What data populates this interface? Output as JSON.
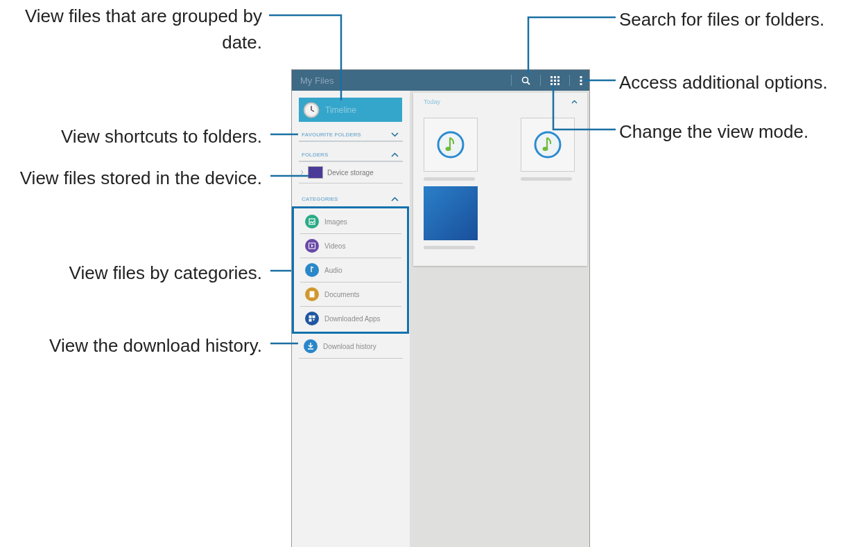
{
  "callouts": [
    {
      "text": "View files that are grouped by date."
    },
    {
      "text": "View shortcuts to folders."
    },
    {
      "text": "View files stored in the device."
    },
    {
      "text": "View files by categories."
    },
    {
      "text": "View the download history."
    },
    {
      "text": "Search for files or folders."
    },
    {
      "text": "Access additional options."
    },
    {
      "text": "Change the view mode."
    }
  ],
  "app": {
    "title": "My Files",
    "actions": [
      {
        "kind": "search"
      },
      {
        "kind": "grid"
      },
      {
        "kind": "more"
      }
    ]
  },
  "timeline": {
    "label": "Timeline",
    "selected": true
  },
  "favourite_folders": {
    "title": "FAVOURITE FOLDERS",
    "expanded": false
  },
  "folders": {
    "title": "FOLDERS",
    "expanded": true,
    "items": [
      {
        "label": "Device storage"
      }
    ]
  },
  "categories": {
    "title": "CATEGORIES",
    "expanded": true,
    "highlighted": true,
    "items": [
      {
        "label": "Images",
        "kind": "images",
        "color": "#2bab86"
      },
      {
        "label": "Videos",
        "kind": "videos",
        "color": "#6a4aa8"
      },
      {
        "label": "Audio",
        "kind": "audio",
        "color": "#2a88c8"
      },
      {
        "label": "Documents",
        "kind": "documents",
        "color": "#d0982e"
      },
      {
        "label": "Downloaded Apps",
        "kind": "apps",
        "color": "#1f56a0"
      }
    ]
  },
  "download_history": {
    "label": "Download history",
    "color": "#2a86c9"
  },
  "content": {
    "date_header": "Today",
    "expanded": true,
    "files": [
      {
        "kind": "audio"
      },
      {
        "kind": "audio"
      },
      {
        "kind": "image"
      }
    ]
  }
}
